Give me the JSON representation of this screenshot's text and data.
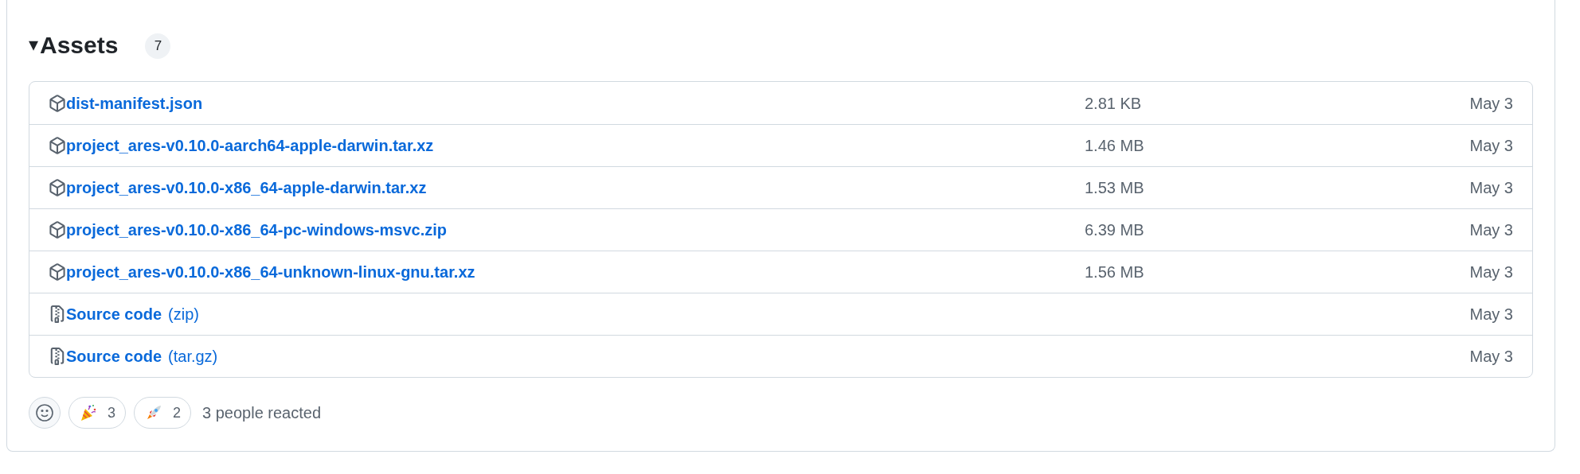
{
  "assets": {
    "toggle": "▾",
    "title": "Assets",
    "expanded": true,
    "count": "7",
    "files": [
      {
        "kind": "package",
        "name": "dist-manifest.json",
        "size": "2.81 KB",
        "date": "May 3"
      },
      {
        "kind": "package",
        "name": "project_ares-v0.10.0-aarch64-apple-darwin.tar.xz",
        "size": "1.46 MB",
        "date": "May 3"
      },
      {
        "kind": "package",
        "name": "project_ares-v0.10.0-x86_64-apple-darwin.tar.xz",
        "size": "1.53 MB",
        "date": "May 3"
      },
      {
        "kind": "package",
        "name": "project_ares-v0.10.0-x86_64-pc-windows-msvc.zip",
        "size": "6.39 MB",
        "date": "May 3"
      },
      {
        "kind": "package",
        "name": "project_ares-v0.10.0-x86_64-unknown-linux-gnu.tar.xz",
        "size": "1.56 MB",
        "date": "May 3"
      },
      {
        "kind": "source",
        "name": "Source code",
        "format": "(zip)",
        "date": "May 3"
      },
      {
        "kind": "source",
        "name": "Source code",
        "format": "(tar.gz)",
        "date": "May 3"
      }
    ]
  },
  "reactions": {
    "items": [
      {
        "kind": "party",
        "count": "3"
      },
      {
        "kind": "rocket",
        "count": "2"
      }
    ],
    "summary": "3 people reacted"
  }
}
